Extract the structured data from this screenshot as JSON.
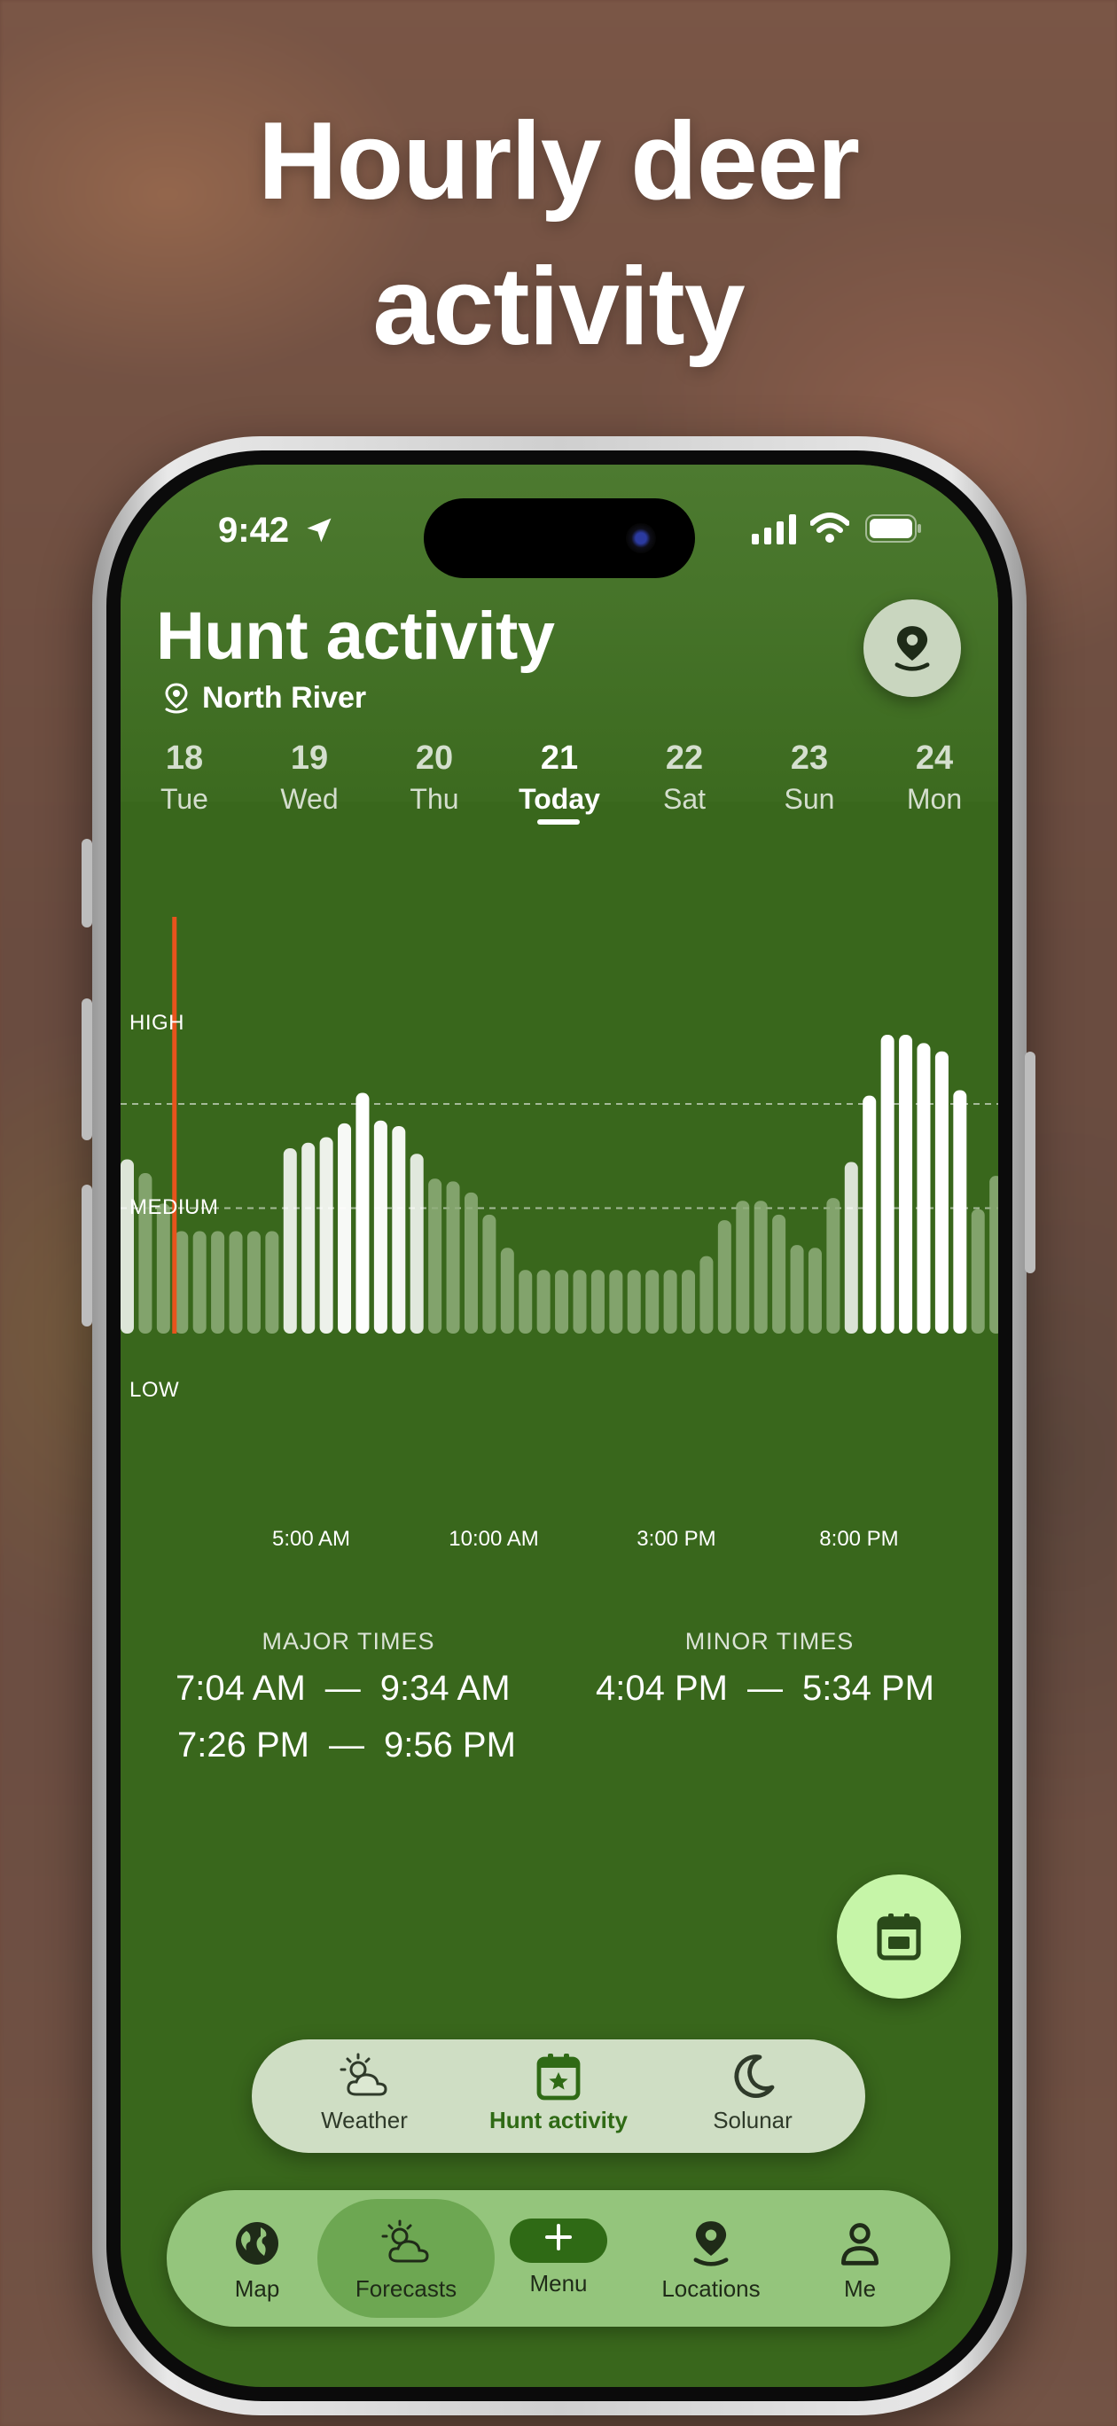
{
  "headline": [
    "Hourly deer",
    "activity"
  ],
  "status": {
    "time": "9:42"
  },
  "screen": {
    "title": "Hunt activity",
    "location": "North River"
  },
  "days": [
    {
      "num": "18",
      "wk": "Tue"
    },
    {
      "num": "19",
      "wk": "Wed"
    },
    {
      "num": "20",
      "wk": "Thu"
    },
    {
      "num": "21",
      "wk": "Today",
      "active": true
    },
    {
      "num": "22",
      "wk": "Sat"
    },
    {
      "num": "23",
      "wk": "Sun"
    },
    {
      "num": "24",
      "wk": "Mon"
    }
  ],
  "levels": {
    "high": "HIGH",
    "medium": "MEDIUM",
    "low": "LOW"
  },
  "chart_data": {
    "type": "bar",
    "series_name": "",
    "y_levels": [
      "LOW",
      "MEDIUM",
      "HIGH"
    ],
    "ticks": [
      "5:00 AM",
      "10:00 AM",
      "3:00 PM",
      "8:00 PM"
    ],
    "current_marker_index": 3,
    "values": [
      0.63,
      0.58,
      0.47,
      0.37,
      0.37,
      0.37,
      0.37,
      0.37,
      0.37,
      0.67,
      0.69,
      0.71,
      0.76,
      0.87,
      0.77,
      0.75,
      0.65,
      0.56,
      0.55,
      0.51,
      0.43,
      0.31,
      0.23,
      0.23,
      0.23,
      0.23,
      0.23,
      0.23,
      0.23,
      0.23,
      0.23,
      0.23,
      0.28,
      0.41,
      0.48,
      0.48,
      0.43,
      0.32,
      0.31,
      0.49,
      0.62,
      0.86,
      1.08,
      1.08,
      1.05,
      1.02,
      0.88,
      0.45,
      0.57
    ]
  },
  "major_times": {
    "label": "MAJOR TIMES",
    "rows": [
      {
        "start": "7:04 AM",
        "end": "9:34 AM"
      },
      {
        "start": "7:26 PM",
        "end": "9:56 PM"
      }
    ]
  },
  "minor_times": {
    "label": "MINOR TIMES",
    "rows": [
      {
        "start": "4:04 PM",
        "end": "5:34 PM"
      }
    ]
  },
  "dash": "—",
  "segment": [
    {
      "label": "Weather",
      "icon": "cloud-sun-icon"
    },
    {
      "label": "Hunt activity",
      "icon": "calendar-star-icon",
      "active": true
    },
    {
      "label": "Solunar",
      "icon": "moon-icon"
    }
  ],
  "tabs": [
    {
      "label": "Map",
      "icon": "globe-icon"
    },
    {
      "label": "Forecasts",
      "icon": "cloud-sun-icon",
      "active": true
    },
    {
      "label": "Menu",
      "icon": "plus-icon"
    },
    {
      "label": "Locations",
      "icon": "map-pin-icon"
    },
    {
      "label": "Me",
      "icon": "person-icon"
    }
  ],
  "colors": {
    "screen_bg": "#39671c",
    "marker": "#e8531c",
    "bar_active": "#ffffff",
    "bar_faded": "#8fae7a"
  }
}
